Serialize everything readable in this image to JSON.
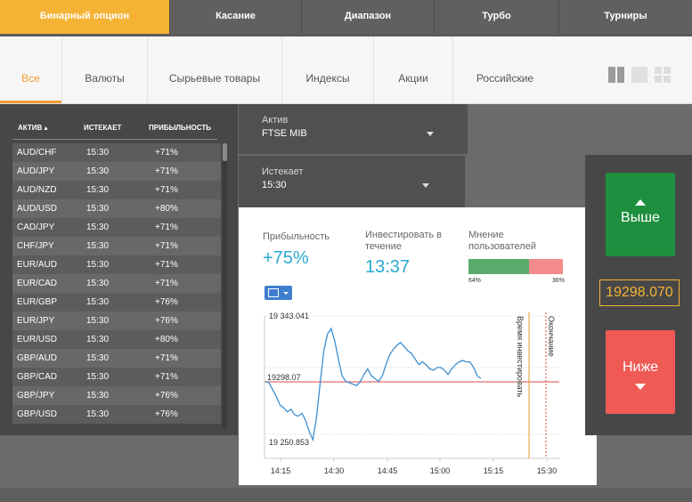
{
  "top_tabs": [
    {
      "label": "Бинарный опцион",
      "active": true
    },
    {
      "label": "Касание",
      "active": false
    },
    {
      "label": "Диапазон",
      "active": false
    },
    {
      "label": "Турбо",
      "active": false
    },
    {
      "label": "Турниры",
      "active": false
    }
  ],
  "categories": [
    {
      "label": "Все",
      "active": true
    },
    {
      "label": "Валюты"
    },
    {
      "label": "Сырьевые товары"
    },
    {
      "label": "Индексы"
    },
    {
      "label": "Акции"
    },
    {
      "label": "Российские"
    }
  ],
  "table": {
    "headers": {
      "asset": "АКТИВ ▴",
      "expires": "ИСТЕКАЕТ",
      "profit": "ПРИБЫЛЬНОСТЬ"
    },
    "rows": [
      {
        "asset": "AUD/CHF",
        "time": "15:30",
        "profit": "+71%"
      },
      {
        "asset": "AUD/JPY",
        "time": "15:30",
        "profit": "+71%"
      },
      {
        "asset": "AUD/NZD",
        "time": "15:30",
        "profit": "+71%"
      },
      {
        "asset": "AUD/USD",
        "time": "15:30",
        "profit": "+80%"
      },
      {
        "asset": "CAD/JPY",
        "time": "15:30",
        "profit": "+71%"
      },
      {
        "asset": "CHF/JPY",
        "time": "15:30",
        "profit": "+71%"
      },
      {
        "asset": "EUR/AUD",
        "time": "15:30",
        "profit": "+71%"
      },
      {
        "asset": "EUR/CAD",
        "time": "15:30",
        "profit": "+71%"
      },
      {
        "asset": "EUR/GBP",
        "time": "15:30",
        "profit": "+76%"
      },
      {
        "asset": "EUR/JPY",
        "time": "15:30",
        "profit": "+76%"
      },
      {
        "asset": "EUR/USD",
        "time": "15:30",
        "profit": "+80%"
      },
      {
        "asset": "GBP/AUD",
        "time": "15:30",
        "profit": "+71%"
      },
      {
        "asset": "GBP/CAD",
        "time": "15:30",
        "profit": "+71%"
      },
      {
        "asset": "GBP/JPY",
        "time": "15:30",
        "profit": "+76%"
      },
      {
        "asset": "GBP/USD",
        "time": "15:30",
        "profit": "+76%"
      }
    ]
  },
  "asset_select": {
    "label": "Актив",
    "value": "FTSE MIB"
  },
  "expiry_select": {
    "label": "Истекает",
    "value": "15:30"
  },
  "stats": {
    "profit_label": "Прибыльность",
    "profit_value": "+75%",
    "invest_label_1": "Инвестировать в",
    "invest_label_2": "течение",
    "invest_value": "13:37",
    "opinion_label_1": "Мнение",
    "opinion_label_2": "пользователей",
    "opinion_up_pct": "64%",
    "opinion_down_pct": "36%"
  },
  "chart_data": {
    "type": "line",
    "y_high_label": "19 343.041",
    "y_low_label": "19 250.853",
    "current_label": "19298.07",
    "x_ticks": [
      "14:15",
      "14:30",
      "14:45",
      "15:00",
      "15:15",
      "15:30"
    ],
    "invest_line_label": "Время инвестировать",
    "end_line_label": "Окончание",
    "ylim": [
      19245,
      19355
    ],
    "x": [
      "14:15",
      "14:16",
      "14:17",
      "14:18",
      "14:19",
      "14:20",
      "14:21",
      "14:22",
      "14:23",
      "14:24",
      "14:25",
      "14:26",
      "14:27",
      "14:28",
      "14:29",
      "14:30",
      "14:31",
      "14:32",
      "14:33",
      "14:34",
      "14:35",
      "14:36",
      "14:37",
      "14:38",
      "14:39",
      "14:40",
      "14:41",
      "14:42",
      "14:43",
      "14:44",
      "14:45",
      "14:46",
      "14:47",
      "14:48",
      "14:49",
      "14:50",
      "14:51",
      "14:52",
      "14:53",
      "14:54",
      "14:55",
      "14:56",
      "14:57",
      "14:58",
      "14:59",
      "15:00",
      "15:01",
      "15:02",
      "15:03",
      "15:04",
      "15:05",
      "15:06",
      "15:07",
      "15:08",
      "15:09",
      "15:10",
      "15:11",
      "15:12",
      "15:13",
      "15:14"
    ],
    "values": [
      19296,
      19295,
      19290,
      19285,
      19279,
      19277,
      19274,
      19276,
      19272,
      19271,
      19273,
      19268,
      19260,
      19254,
      19270,
      19295,
      19318,
      19330,
      19334,
      19325,
      19312,
      19300,
      19296,
      19295,
      19294,
      19293,
      19296,
      19301,
      19305,
      19300,
      19298,
      19296,
      19300,
      19308,
      19315,
      19319,
      19322,
      19324,
      19321,
      19318,
      19316,
      19312,
      19308,
      19310,
      19308,
      19305,
      19304,
      19306,
      19306,
      19304,
      19301,
      19305,
      19308,
      19310,
      19311,
      19310,
      19310,
      19306,
      19300,
      19298
    ]
  },
  "price": "19298.070",
  "buttons": {
    "up": "Выше",
    "down": "Ниже"
  },
  "colors": {
    "accent": "#f5b335",
    "up": "#1e8f3e",
    "down": "#f05a55",
    "line": "#3d8fd1",
    "value": "#29a9cf"
  }
}
